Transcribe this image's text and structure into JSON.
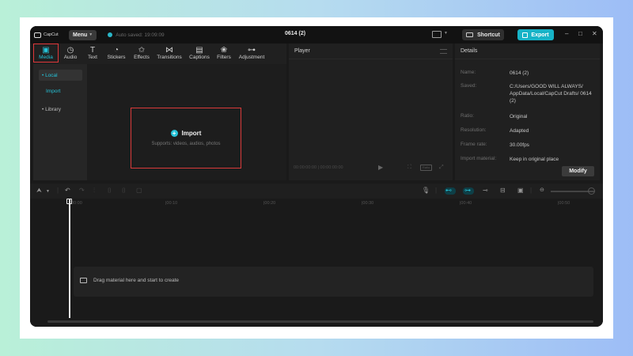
{
  "app": {
    "logo_text": "CapCut",
    "menu_label": "Menu",
    "autosave": "Auto saved: 19:09:09",
    "project_title": "0614 (2)",
    "shortcut_label": "Shortcut",
    "export_label": "Export",
    "accent_color": "#17b3c7",
    "highlight_color": "#d83a3a"
  },
  "media_tabs": [
    {
      "label": "Media",
      "icon": "media-icon",
      "active": true
    },
    {
      "label": "Audio",
      "icon": "audio-icon"
    },
    {
      "label": "Text",
      "icon": "text-icon"
    },
    {
      "label": "Stickers",
      "icon": "stickers-icon"
    },
    {
      "label": "Effects",
      "icon": "effects-icon"
    },
    {
      "label": "Transitions",
      "icon": "transitions-icon"
    },
    {
      "label": "Captions",
      "icon": "captions-icon"
    },
    {
      "label": "Filters",
      "icon": "filters-icon"
    },
    {
      "label": "Adjustment",
      "icon": "adjustment-icon"
    }
  ],
  "media_sidebar": {
    "local": "• Local",
    "import": "Import",
    "library": "• Library"
  },
  "import_box": {
    "title": "Import",
    "hint": "Supports: videos, audios, photos"
  },
  "player": {
    "title": "Player",
    "time": "00:00:00:00 | 00:00:00:00",
    "ratio": "Ratio"
  },
  "details": {
    "title": "Details",
    "rows": [
      {
        "label": "Name:",
        "value": "0614 (2)"
      },
      {
        "label": "Saved:",
        "value": "C:/Users/GOOD WILL ALWAYS/ AppData/Local/CapCut Drafts/ 0614 (2)"
      },
      {
        "label": "Ratio:",
        "value": "Original"
      },
      {
        "label": "Resolution:",
        "value": "Adapted"
      },
      {
        "label": "Frame rate:",
        "value": "30.00fps"
      },
      {
        "label": "Import material:",
        "value": "Keep in original place"
      }
    ],
    "modify_label": "Modify"
  },
  "timeline": {
    "ticks": [
      "00:00",
      "|00:10",
      "|00:20",
      "|00:30",
      "|00:40",
      "|00:50"
    ],
    "drag_hint": "Drag material here and start to create"
  }
}
